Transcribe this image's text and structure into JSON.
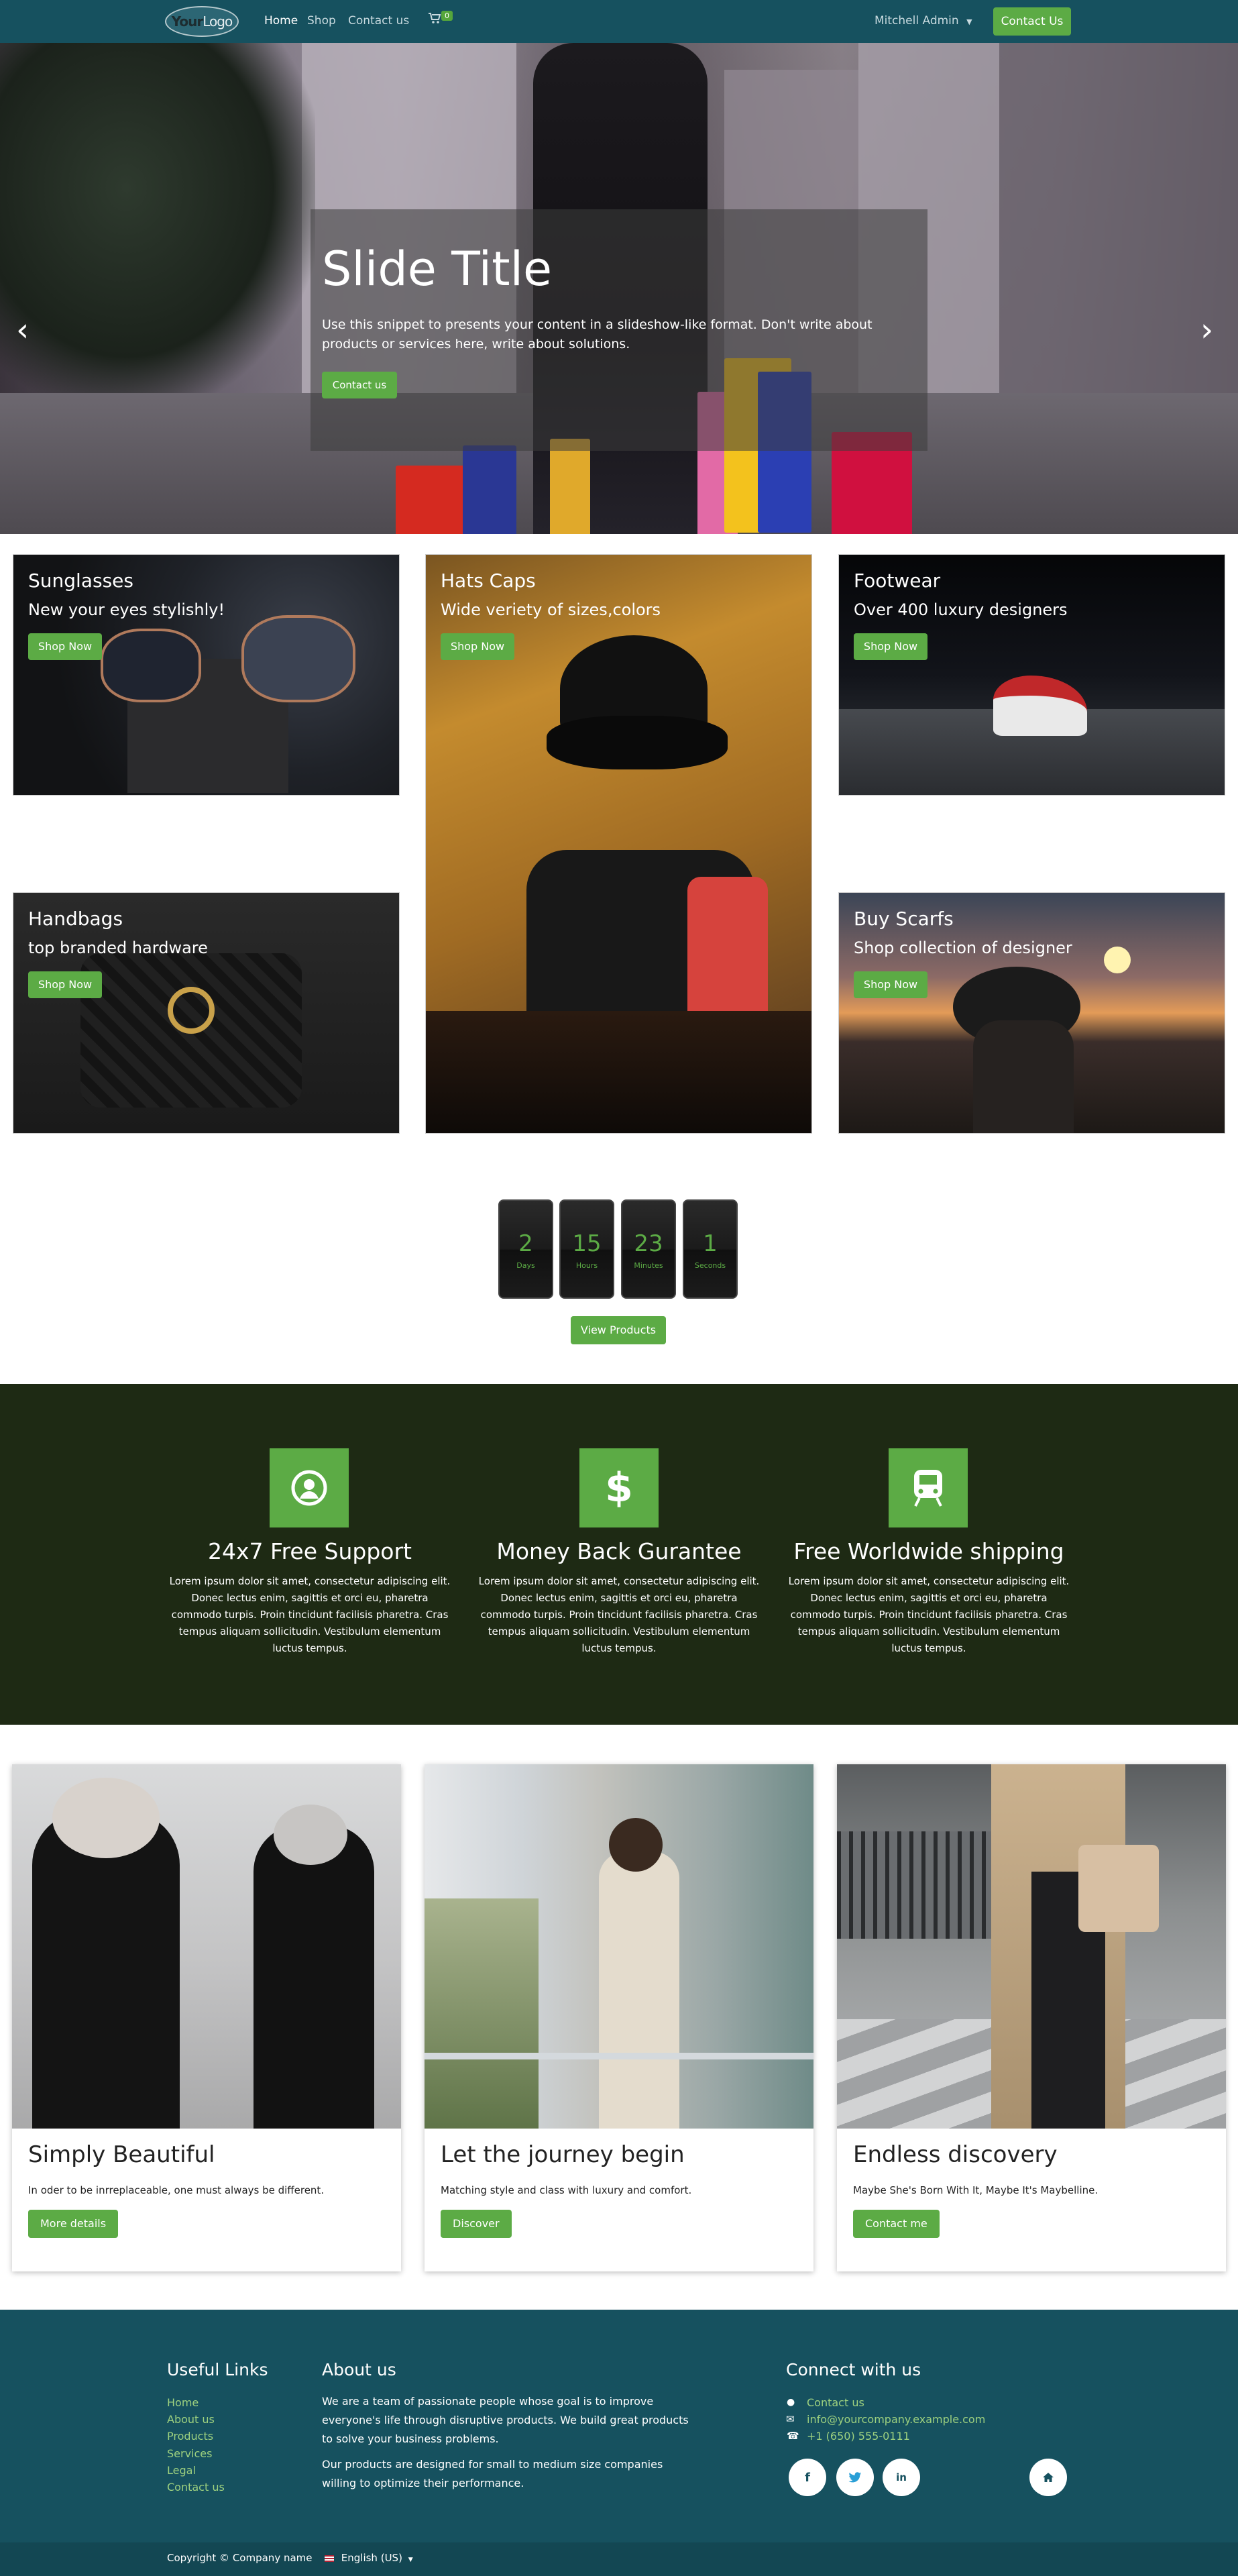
{
  "navbar": {
    "logo_bold": "Your",
    "logo_light": "Logo",
    "links": [
      "Home",
      "Shop",
      "Contact us"
    ],
    "cart_count": "0",
    "user": "Mitchell Admin",
    "cta": "Contact Us"
  },
  "hero": {
    "title": "Slide Title",
    "text": "Use this snippet to presents your content in a slideshow-like format. Don't write about products or services here, write about solutions.",
    "button": "Contact us",
    "indicator_count": 3,
    "active_indicator": 0
  },
  "categories": [
    {
      "title": "Sunglasses",
      "subtitle": "New your eyes stylishly!",
      "button": "Shop Now"
    },
    {
      "title": "Hats Caps",
      "subtitle": "Wide veriety of sizes,colors",
      "button": "Shop Now"
    },
    {
      "title": "Footwear",
      "subtitle": "Over 400 luxury designers",
      "button": "Shop Now"
    },
    {
      "title": "Handbags",
      "subtitle": "top branded hardware",
      "button": "Shop Now"
    },
    {
      "title": "Buy Scarfs",
      "subtitle": "Shop collection of designer",
      "button": "Shop Now"
    }
  ],
  "countdown": {
    "units": [
      {
        "value": "2",
        "label": "Days"
      },
      {
        "value": "15",
        "label": "Hours"
      },
      {
        "value": "23",
        "label": "Minutes"
      },
      {
        "value": "1",
        "label": "Seconds"
      }
    ],
    "button": "View Products"
  },
  "features": [
    {
      "icon": "user-circle-icon",
      "title": "24x7 Free Support",
      "text": "Lorem ipsum dolor sit amet, consectetur adipiscing elit. Donec lectus enim, sagittis et orci eu, pharetra commodo turpis. Proin tincidunt facilisis pharetra. Cras tempus aliquam sollicitudin. Vestibulum elementum luctus tempus."
    },
    {
      "icon": "dollar-icon",
      "title": "Money Back Gurantee",
      "text": "Lorem ipsum dolor sit amet, consectetur adipiscing elit. Donec lectus enim, sagittis et orci eu, pharetra commodo turpis. Proin tincidunt facilisis pharetra. Cras tempus aliquam sollicitudin. Vestibulum elementum luctus tempus."
    },
    {
      "icon": "train-icon",
      "title": "Free Worldwide shipping",
      "text": "Lorem ipsum dolor sit amet, consectetur adipiscing elit. Donec lectus enim, sagittis et orci eu, pharetra commodo turpis. Proin tincidunt facilisis pharetra. Cras tempus aliquam sollicitudin. Vestibulum elementum luctus tempus."
    }
  ],
  "cards": [
    {
      "title": "Simply Beautiful",
      "text": "In oder to be inrreplaceable, one must always be different.",
      "button": "More details"
    },
    {
      "title": "Let the journey begin",
      "text": "Matching style and class with luxury and comfort.",
      "button": "Discover"
    },
    {
      "title": "Endless discovery",
      "text": "Maybe She's Born With It, Maybe It's Maybelline.",
      "button": "Contact me"
    }
  ],
  "footer": {
    "useful_links_heading": "Useful Links",
    "useful_links": [
      "Home",
      "About us",
      "Products",
      "Services",
      "Legal",
      "Contact us"
    ],
    "about_heading": "About us",
    "about_p1": "We are a team of passionate people whose goal is to improve everyone's life through disruptive products. We build great products to solve your business problems.",
    "about_p2": "Our products are designed for small to medium size companies willing to optimize their performance.",
    "connect_heading": "Connect with us",
    "contact_link": "Contact us",
    "email": "info@yourcompany.example.com",
    "phone": "+1 (650) 555-0111",
    "copyright": "Copyright © Company name",
    "language": "English (US)"
  },
  "colors": {
    "navbar": "#16515f",
    "accent": "#5cab45",
    "features_bg": "#1e2a14",
    "footer_link": "#9ed17f"
  }
}
